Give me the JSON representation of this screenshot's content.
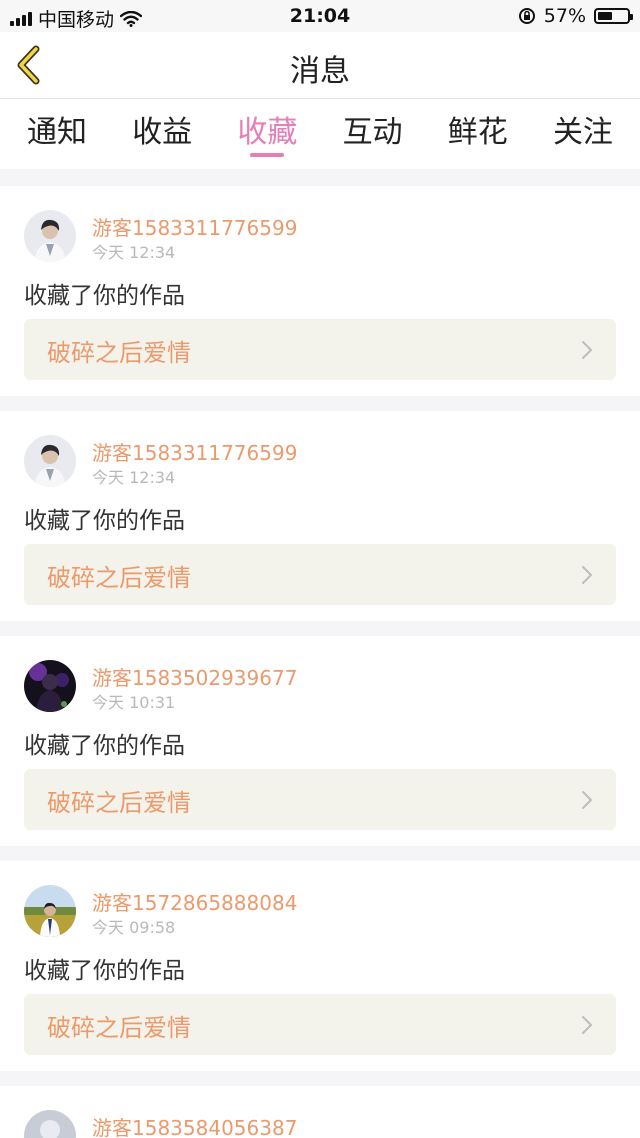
{
  "status_bar": {
    "carrier": "中国移动",
    "time": "21:04",
    "battery_percent": "57%",
    "battery_level": 0.57
  },
  "header": {
    "back_icon": "chevron-left-icon",
    "title": "消息"
  },
  "tabs": [
    {
      "label": "通知",
      "active": false
    },
    {
      "label": "收益",
      "active": false
    },
    {
      "label": "收藏",
      "active": true
    },
    {
      "label": "互动",
      "active": false
    },
    {
      "label": "鲜花",
      "active": false
    },
    {
      "label": "关注",
      "active": false
    }
  ],
  "colors": {
    "accent": "#e67eb7",
    "username": "#eb9a6c",
    "work_bg": "#f3f3eb"
  },
  "messages": [
    {
      "username": "游客1583311776599",
      "time": "今天 12:34",
      "action": "收藏了你的作品",
      "work": "破碎之后爱情",
      "avatar": "person-in-white-avatar"
    },
    {
      "username": "游客1583311776599",
      "time": "今天 12:34",
      "action": "收藏了你的作品",
      "work": "破碎之后爱情",
      "avatar": "person-in-white-avatar"
    },
    {
      "username": "游客1583502939677",
      "time": "今天 10:31",
      "action": "收藏了你的作品",
      "work": "破碎之后爱情",
      "avatar": "dark-purple-avatar"
    },
    {
      "username": "游客1572865888084",
      "time": "今天 09:58",
      "action": "收藏了你的作品",
      "work": "破碎之后爱情",
      "avatar": "person-outdoors-avatar"
    },
    {
      "username": "游客1583584056387",
      "avatar": "default-avatar"
    }
  ]
}
